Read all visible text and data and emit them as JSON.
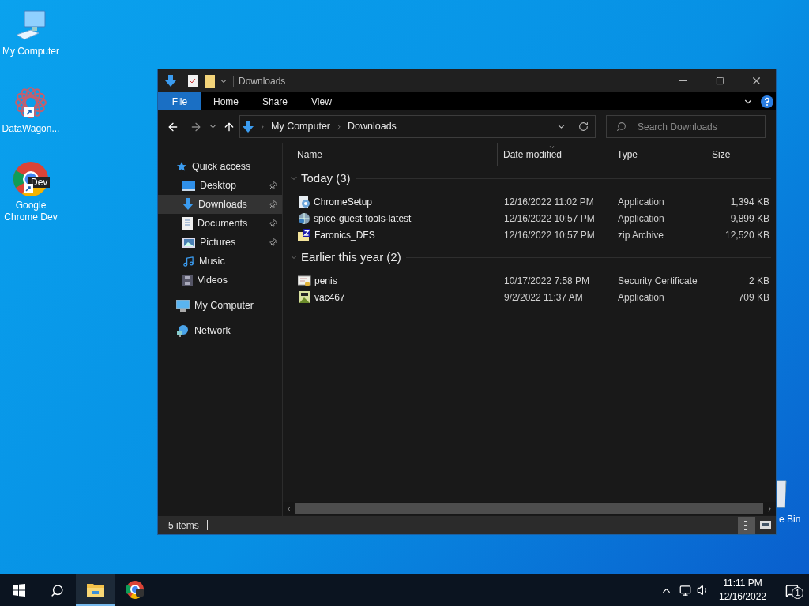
{
  "desktop_icons": [
    {
      "label": "My Computer",
      "kind": "computer",
      "shortcut": false
    },
    {
      "label": "DataWagon...",
      "kind": "datawagon",
      "shortcut": true
    },
    {
      "label": "Google Chrome Dev",
      "kind": "chrome",
      "shortcut": true,
      "badge": "Dev"
    },
    {
      "label": "e Bin",
      "kind": "bin"
    }
  ],
  "window": {
    "title": "Downloads",
    "ribbon_tabs": [
      {
        "label": "File",
        "selected": true
      },
      {
        "label": "Home",
        "selected": false
      },
      {
        "label": "Share",
        "selected": false
      },
      {
        "label": "View",
        "selected": false
      }
    ],
    "address": {
      "path": [
        "My Computer",
        "Downloads"
      ]
    },
    "search": {
      "placeholder": "Search Downloads"
    },
    "sidebar": {
      "items": [
        {
          "label": "Quick access",
          "kind": "star",
          "selected": false,
          "children": [
            {
              "label": "Desktop",
              "kind": "desktop",
              "pinned": true,
              "selected": false
            },
            {
              "label": "Downloads",
              "kind": "downloads",
              "pinned": true,
              "selected": true
            },
            {
              "label": "Documents",
              "kind": "documents",
              "pinned": true,
              "selected": false
            },
            {
              "label": "Pictures",
              "kind": "pictures",
              "pinned": true,
              "selected": false
            },
            {
              "label": "Music",
              "kind": "music",
              "pinned": false,
              "selected": false
            },
            {
              "label": "Videos",
              "kind": "videos",
              "pinned": false,
              "selected": false
            }
          ]
        },
        {
          "label": "My Computer",
          "kind": "computer",
          "selected": false
        },
        {
          "label": "Network",
          "kind": "network",
          "selected": false
        }
      ]
    },
    "columns": [
      {
        "label": "Name",
        "sorted": false
      },
      {
        "label": "Date modified",
        "sorted": true
      },
      {
        "label": "Type",
        "sorted": false
      },
      {
        "label": "Size",
        "sorted": false
      }
    ],
    "groups": [
      {
        "title": "Today (3)",
        "expanded": true,
        "files": [
          {
            "name": "ChromeSetup",
            "kind": "setup",
            "date": "12/16/2022 11:02 PM",
            "type": "Application",
            "size": "1,394 KB"
          },
          {
            "name": "spice-guest-tools-latest",
            "kind": "globe",
            "date": "12/16/2022 10:57 PM",
            "type": "Application",
            "size": "9,899 KB"
          },
          {
            "name": "Faronics_DFS",
            "kind": "zip",
            "date": "12/16/2022 10:57 PM",
            "type": "zip Archive",
            "size": "12,520 KB"
          }
        ]
      },
      {
        "title": "Earlier this year (2)",
        "expanded": true,
        "files": [
          {
            "name": "penis",
            "kind": "cert",
            "date": "10/17/2022 7:58 PM",
            "type": "Security Certificate",
            "size": "2 KB"
          },
          {
            "name": "vac467",
            "kind": "app",
            "date": "9/2/2022 11:37 AM",
            "type": "Application",
            "size": "709 KB"
          }
        ]
      }
    ],
    "status_bar": {
      "text": "5 items",
      "views": [
        {
          "kind": "details",
          "selected": true
        },
        {
          "kind": "large",
          "selected": false
        }
      ]
    }
  },
  "taskbar": {
    "apps": [
      {
        "kind": "explorer",
        "active": true
      },
      {
        "kind": "chrome",
        "active": false
      }
    ],
    "time": "11:11 PM",
    "date": "12/16/2022",
    "notification_count": "1"
  }
}
